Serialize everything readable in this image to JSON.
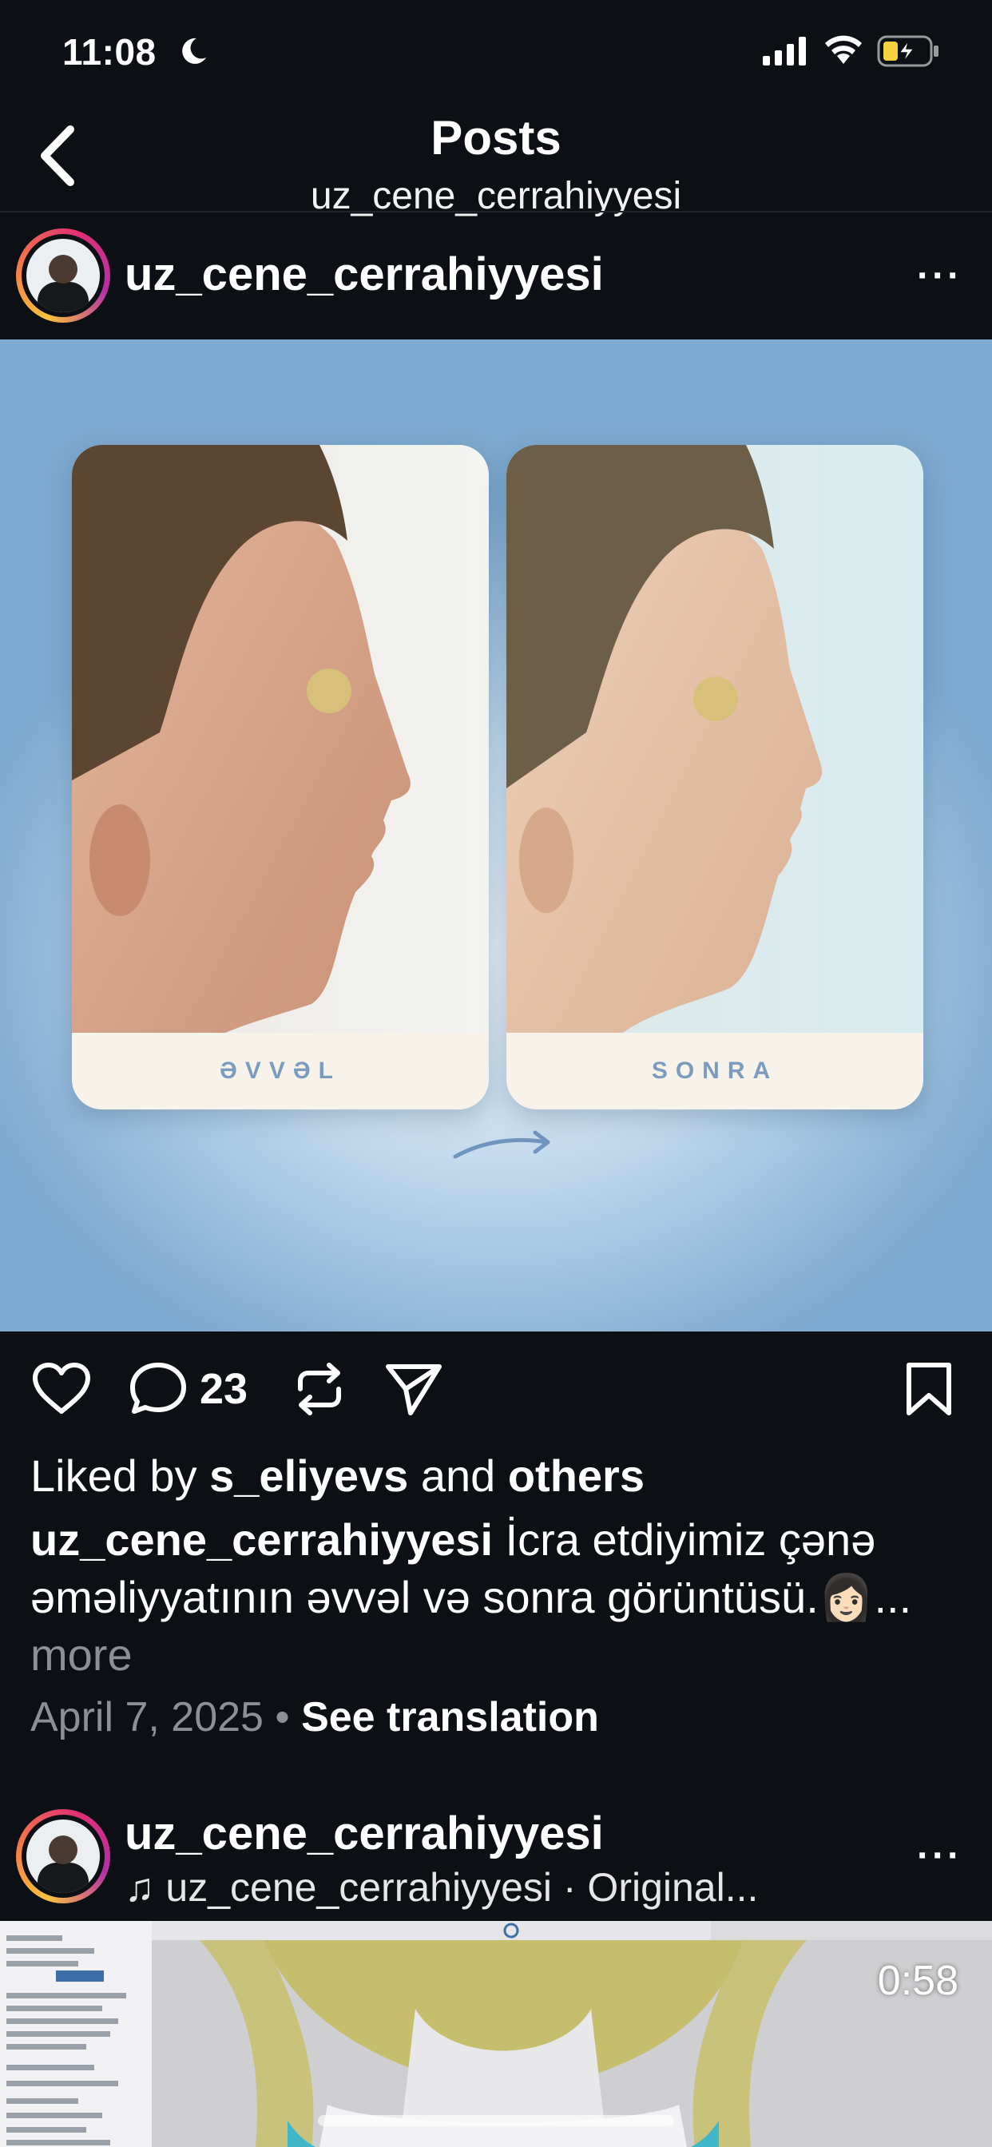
{
  "status_bar": {
    "time": "11:08"
  },
  "header": {
    "title": "Posts",
    "subtitle": "uz_cene_cerrahiyyesi"
  },
  "post1": {
    "username": "uz_cene_cerrahiyyesi",
    "more": "···",
    "image": {
      "before_label": "ƏVVƏL",
      "after_label": "SONRA"
    },
    "comment_count": "23",
    "likes": {
      "prefix": "Liked by ",
      "user": "s_eliyevs",
      "middle": " and ",
      "others": "others"
    },
    "caption": {
      "username": "uz_cene_cerrahiyyesi",
      "text": " İcra etdiyimiz çənə əməliyyatının əvvəl və sonra görüntüsü.👩🏻",
      "ellipsis": "... ",
      "more": "more"
    },
    "date": "April 7, 2025",
    "separator": " • ",
    "see_translation": "See translation"
  },
  "post2": {
    "username": "uz_cene_cerrahiyyesi",
    "audio_icon": "♫",
    "audio_text": "uz_cene_cerrahiyyesi · Original...",
    "more": "···",
    "video_duration": "0:58"
  },
  "colors": {
    "background": "#0c0f14",
    "muted_text": "#8a8f98",
    "image_label_blue": "#7b9cbf",
    "image_background_blue": "#7ea9d0"
  }
}
